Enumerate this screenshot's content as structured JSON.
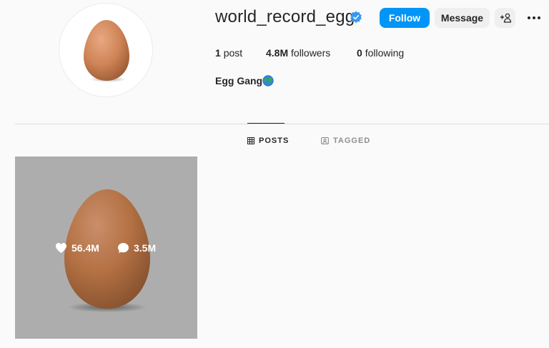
{
  "profile": {
    "username": "world_record_egg",
    "verified": true,
    "full_name": "Egg Gang",
    "full_name_emoji": "globe-icon"
  },
  "actions": {
    "follow_label": "Follow",
    "message_label": "Message",
    "suggest_label": "+",
    "more_icon": "more-horizontal-icon"
  },
  "stats": {
    "posts": {
      "count": "1",
      "label": "post"
    },
    "followers": {
      "count": "4.8M",
      "label": "followers"
    },
    "following": {
      "count": "0",
      "label": "following"
    }
  },
  "tabs": [
    {
      "label": "POSTS",
      "icon": "grid-icon",
      "active": true
    },
    {
      "label": "TAGGED",
      "icon": "tagged-icon",
      "active": false
    }
  ],
  "posts": [
    {
      "likes": "56.4M",
      "comments": "3.5M",
      "image": "egg"
    }
  ],
  "colors": {
    "accent": "#0095f6",
    "verified": "#3897f0",
    "background": "#fafafa",
    "secondary_button": "#efefef",
    "muted_text": "#8e8e8e"
  }
}
